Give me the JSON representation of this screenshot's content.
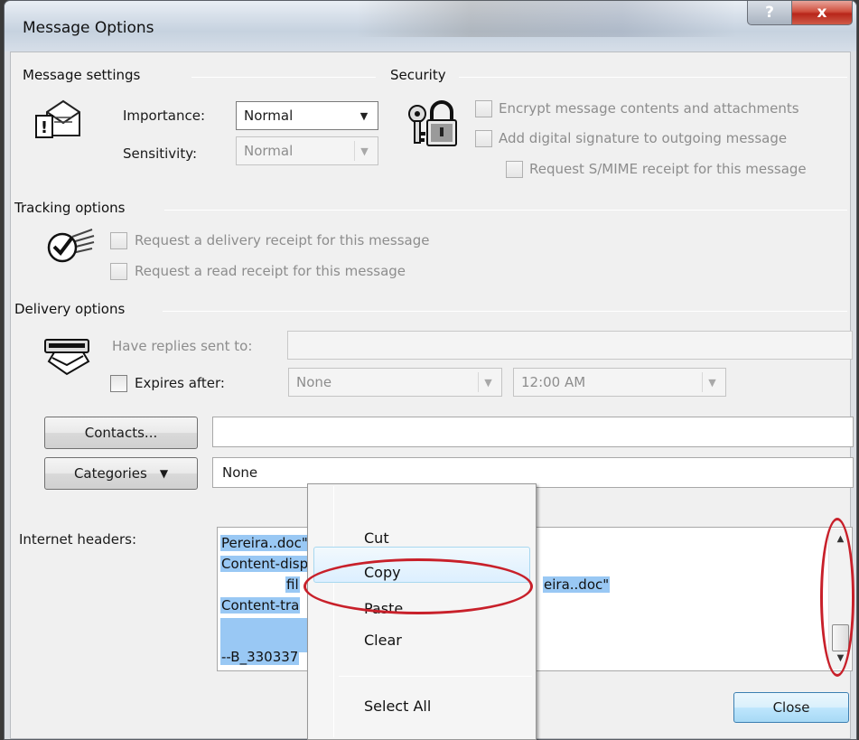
{
  "window": {
    "title": "Message Options",
    "help_glyph": "?",
    "close_glyph": "x"
  },
  "message_settings": {
    "label": "Message settings",
    "importance_label": "Importance:",
    "importance_value": "Normal",
    "sensitivity_label": "Sensitivity:",
    "sensitivity_value": "Normal"
  },
  "security": {
    "label": "Security",
    "encrypt": "Encrypt message contents and attachments",
    "signature": "Add digital signature to outgoing message",
    "smime": "Request S/MIME receipt for this message"
  },
  "tracking": {
    "label": "Tracking options",
    "delivery_receipt": "Request a delivery receipt for this message",
    "read_receipt": "Request a read receipt for this message"
  },
  "delivery": {
    "label": "Delivery options",
    "replies_label": "Have replies sent to:",
    "expires_label": "Expires after:",
    "expires_date": "None",
    "expires_time": "12:00 AM"
  },
  "contacts": {
    "button": "Contacts...",
    "value": ""
  },
  "categories": {
    "button": "Categories",
    "value": "None"
  },
  "headers": {
    "label": "Internet headers:",
    "lines": [
      "Pereira..doc\"",
      "Content-disp",
      "fil",
      "eira..doc\"",
      "Content-tra",
      "",
      "--B_330337"
    ]
  },
  "context_menu": {
    "cut": "Cut",
    "copy": "Copy",
    "paste": "Paste",
    "clear": "Clear",
    "select_all": "Select All"
  },
  "footer": {
    "close_button": "Close"
  },
  "colors": {
    "annotation": "#c8202a",
    "selection": "#99c8f4",
    "menu_highlight": "#dcefff"
  }
}
